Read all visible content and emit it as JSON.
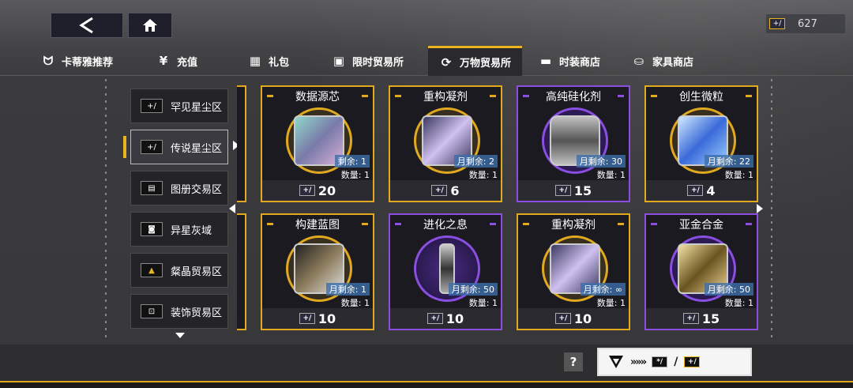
{
  "currency": {
    "amount": "627"
  },
  "tabs": [
    {
      "label": "卡蒂雅推荐",
      "icon": "bunny-icon"
    },
    {
      "label": "充值",
      "icon": "yen-icon"
    },
    {
      "label": "礼包",
      "icon": "gift-icon"
    },
    {
      "label": "限时贸易所",
      "icon": "timer-shop-icon"
    },
    {
      "label": "万物贸易所",
      "icon": "exchange-icon"
    },
    {
      "label": "时装商店",
      "icon": "wardrobe-icon"
    },
    {
      "label": "家具商店",
      "icon": "sofa-icon"
    }
  ],
  "sidebar": [
    {
      "label": "罕见星尘区"
    },
    {
      "label": "传说星尘区"
    },
    {
      "label": "图册交易区"
    },
    {
      "label": "异星灰域"
    },
    {
      "label": "粲晶贸易区"
    },
    {
      "label": "装饰贸易区"
    }
  ],
  "cards": [
    {
      "title": "数据源芯",
      "monthly": "剩余: 1",
      "qty": "数量: 1",
      "price": "20",
      "rarity": "gold"
    },
    {
      "title": "重构凝剂",
      "monthly": "月剩余: 2",
      "qty": "数量: 1",
      "price": "6",
      "rarity": "gold"
    },
    {
      "title": "高纯硅化剂",
      "monthly": "月剩余: 30",
      "qty": "数量: 1",
      "price": "15",
      "rarity": "purple"
    },
    {
      "title": "创生微粒",
      "monthly": "月剩余: 22",
      "qty": "数量: 1",
      "price": "4",
      "rarity": "gold"
    },
    {
      "title": "构建蓝图",
      "monthly": "月剩余: 1",
      "qty": "数量: 1",
      "price": "10",
      "rarity": "gold"
    },
    {
      "title": "进化之息",
      "monthly": "月剩余: 50",
      "qty": "数量: 1",
      "price": "10",
      "rarity": "purple"
    },
    {
      "title": "重构凝剂",
      "monthly": "月剩余: ∞",
      "qty": "数量: 1",
      "price": "10",
      "rarity": "gold"
    },
    {
      "title": "亚金合金",
      "monthly": "月剩余: 50",
      "qty": "数量: 1",
      "price": "15",
      "rarity": "purple"
    }
  ],
  "bottom": {
    "help": "?",
    "separator": "/"
  }
}
